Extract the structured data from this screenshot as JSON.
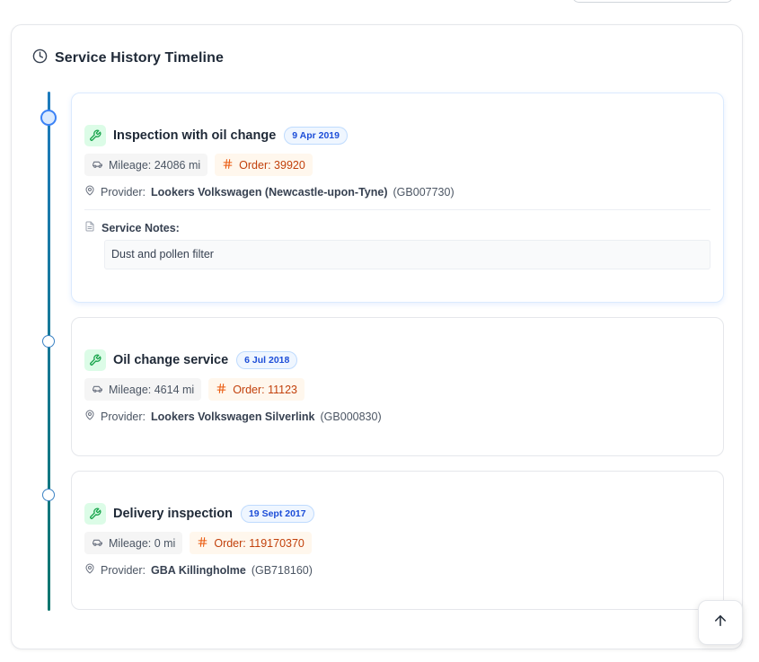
{
  "header": {
    "title": "Service History Timeline",
    "icon": "clock-icon"
  },
  "entries": [
    {
      "title": "Inspection with oil change",
      "date": "9 Apr 2019",
      "mileage": "Mileage: 24086 mi",
      "order": "Order: 39920",
      "provider_label": "Provider:",
      "provider_name": "Lookers Volkswagen (Newcastle-upon-Tyne)",
      "provider_code": "(GB007730)",
      "notes_label": "Service Notes:",
      "notes": "Dust and pollen filter"
    },
    {
      "title": "Oil change service",
      "date": "6 Jul 2018",
      "mileage": "Mileage: 4614 mi",
      "order": "Order: 11123",
      "provider_label": "Provider:",
      "provider_name": "Lookers Volkswagen Silverlink",
      "provider_code": "(GB000830)"
    },
    {
      "title": "Delivery inspection",
      "date": "19 Sept 2017",
      "mileage": "Mileage: 0 mi",
      "order": "Order: 119170370",
      "provider_label": "Provider:",
      "provider_name": "GBA Killingholme",
      "provider_code": "(GB718160)"
    }
  ],
  "colors": {
    "accent": "#3b82f6",
    "timeline_top": "#1d7bbd",
    "timeline_bottom": "#0f766e",
    "order_text": "#c2410c",
    "wrench_bg": "#dcfce7",
    "wrench_fg": "#16a34a"
  },
  "icons": {
    "entry": "wrench-icon",
    "mileage": "car-icon",
    "order": "hash-icon",
    "provider": "map-pin-icon",
    "notes": "document-icon",
    "scroll": "arrow-up-icon"
  }
}
